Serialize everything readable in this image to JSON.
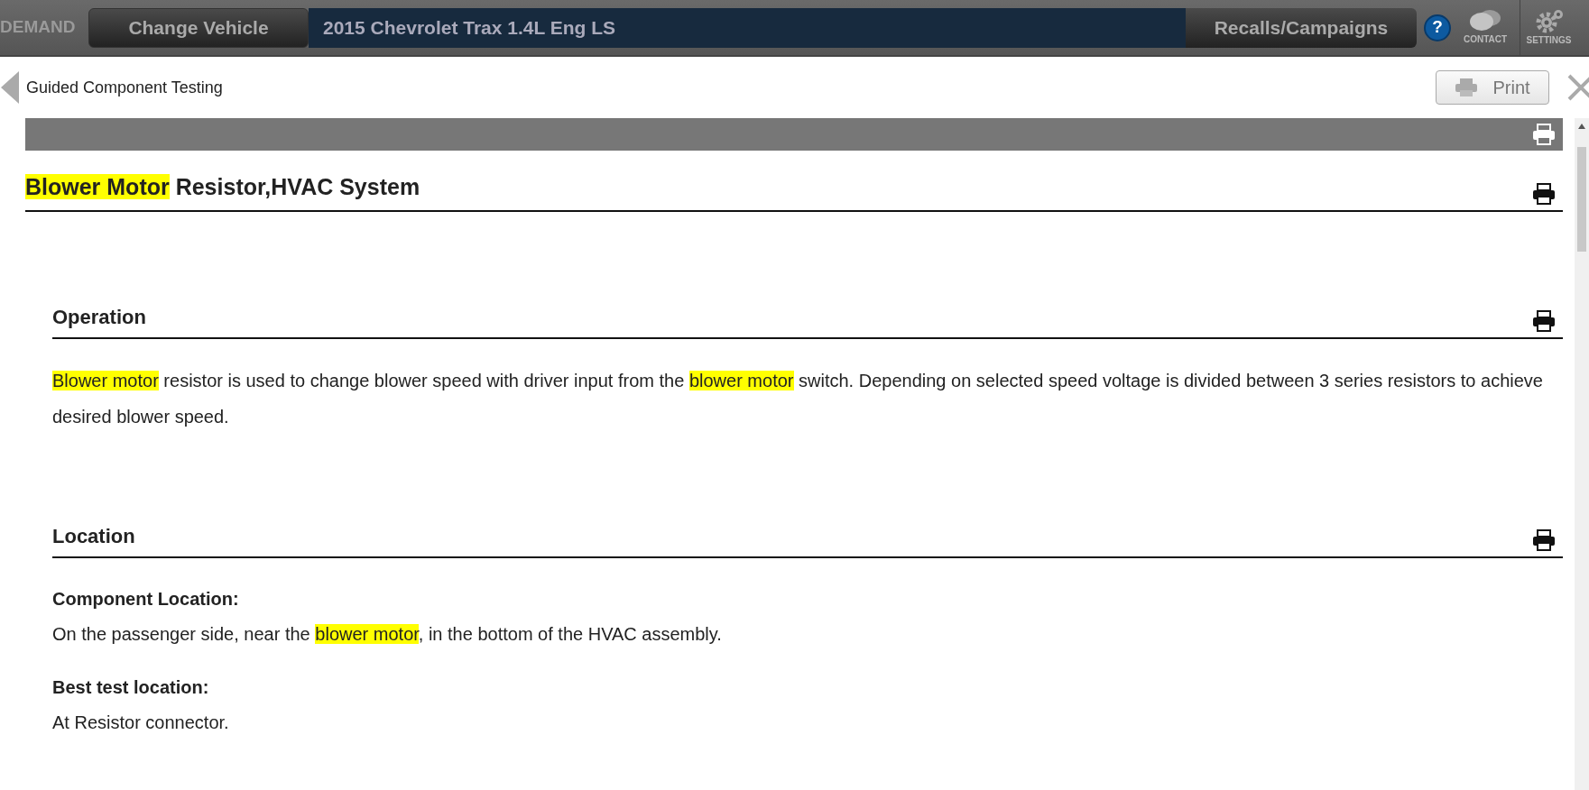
{
  "top_bar": {
    "brand": "DEMAND",
    "change_vehicle": "Change Vehicle",
    "vehicle": "2015 Chevrolet Trax 1.4L Eng LS",
    "recalls": "Recalls/Campaigns",
    "help": "?",
    "contact": "CONTACT",
    "settings": "SETTINGS"
  },
  "sub_bar": {
    "back_label": "Guided Component Testing",
    "print": "Print"
  },
  "document": {
    "title": [
      {
        "text": "Blower Motor",
        "highlight": true
      },
      {
        "text": " Resistor,HVAC System",
        "highlight": false
      }
    ],
    "sections": [
      {
        "heading": "Operation",
        "blocks": [
          {
            "kind": "paragraph",
            "segments": [
              {
                "text": "Blower motor",
                "highlight": true
              },
              {
                "text": " resistor is used to change blower speed with driver input from the ",
                "highlight": false
              },
              {
                "text": "blower motor",
                "highlight": true
              },
              {
                "text": " switch. Depending on selected speed voltage is divided between 3 series resistors to achieve desired blower speed.",
                "highlight": false
              }
            ]
          }
        ]
      },
      {
        "heading": "Location",
        "blocks": [
          {
            "kind": "label",
            "segments": [
              {
                "text": "Component Location:",
                "highlight": false
              }
            ]
          },
          {
            "kind": "paragraph",
            "segments": [
              {
                "text": "On the passenger side, near the ",
                "highlight": false
              },
              {
                "text": "blower motor",
                "highlight": true
              },
              {
                "text": ", in the bottom of the HVAC assembly.",
                "highlight": false
              }
            ]
          },
          {
            "kind": "label",
            "segments": [
              {
                "text": "Best test location:",
                "highlight": false
              }
            ]
          },
          {
            "kind": "paragraph",
            "segments": [
              {
                "text": "At Resistor connector.",
                "highlight": false
              }
            ]
          }
        ]
      }
    ]
  }
}
